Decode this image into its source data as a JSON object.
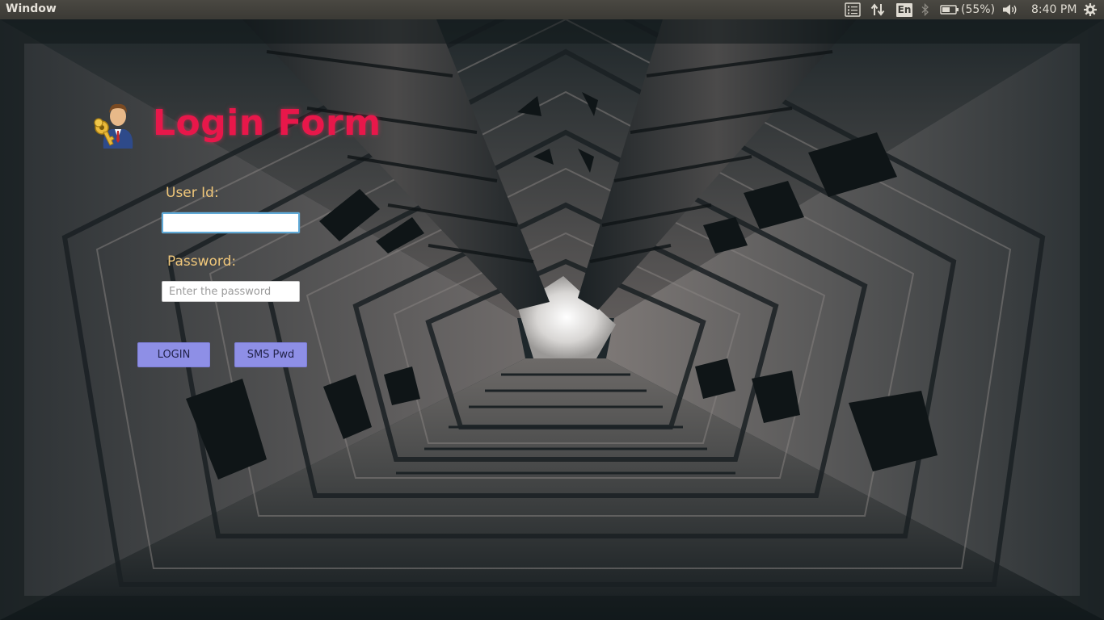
{
  "panel": {
    "title": "Window",
    "language": "En",
    "battery": "(55%)",
    "time": "8:40 PM",
    "icons": [
      "menu-icon",
      "network-updown-icon",
      "bluetooth-icon",
      "battery-icon",
      "volume-icon",
      "gear-icon"
    ]
  },
  "form": {
    "title": "Login Form",
    "title_color": "#e8174a",
    "label_color": "#f0c77a",
    "button_color": "#8e8fe6",
    "user_label": "User Id:",
    "user_value": "",
    "password_label": "Password:",
    "password_placeholder": "Enter the password",
    "login_label": "LOGIN",
    "sms_label": "SMS Pwd",
    "logo_icon": "user-key-icon"
  }
}
